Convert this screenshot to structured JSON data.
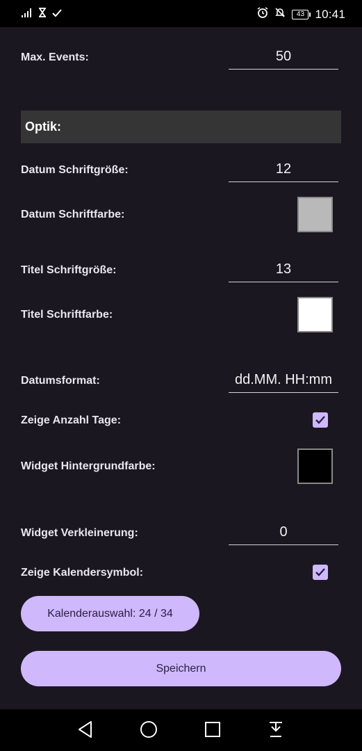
{
  "status_bar": {
    "time": "10:41",
    "battery": "43",
    "left_icons": [
      "signal-icon",
      "hourglass-icon",
      "check-icon"
    ],
    "right_icons": [
      "alarm-icon",
      "mute-icon",
      "battery-icon"
    ]
  },
  "settings": {
    "max_events_label": "Max. Events:",
    "max_events_value": "50",
    "section_optik": "Optik:",
    "datum_schriftgroesse_label": "Datum Schriftgröße:",
    "datum_schriftgroesse_value": "12",
    "datum_schriftfarbe_label": "Datum Schriftfarbe:",
    "datum_schriftfarbe_color": "#b9b9b9",
    "titel_schriftgroesse_label": "Titel Schriftgröße:",
    "titel_schriftgroesse_value": "13",
    "titel_schriftfarbe_label": "Titel Schriftfarbe:",
    "titel_schriftfarbe_color": "#ffffff",
    "datumsformat_label": "Datumsformat:",
    "datumsformat_value": "dd.MM. HH:mm",
    "zeige_anzahl_tage_label": "Zeige Anzahl Tage:",
    "zeige_anzahl_tage_checked": true,
    "widget_hintergrundfarbe_label": "Widget Hintergrundfarbe:",
    "widget_hintergrundfarbe_color": "#000000",
    "widget_verkleinerung_label": "Widget Verkleinerung:",
    "widget_verkleinerung_value": "0",
    "zeige_kalendersymbol_label": "Zeige Kalendersymbol:",
    "zeige_kalendersymbol_checked": true
  },
  "buttons": {
    "kalenderauswahl": "Kalenderauswahl: 24 / 34",
    "speichern": "Speichern"
  },
  "colors": {
    "accent": "#cfb8fb",
    "background": "#1b1720",
    "section": "#353535"
  },
  "nav_bar": {
    "icons": [
      "back-icon",
      "home-icon",
      "recents-icon",
      "notification-shade-icon"
    ]
  }
}
